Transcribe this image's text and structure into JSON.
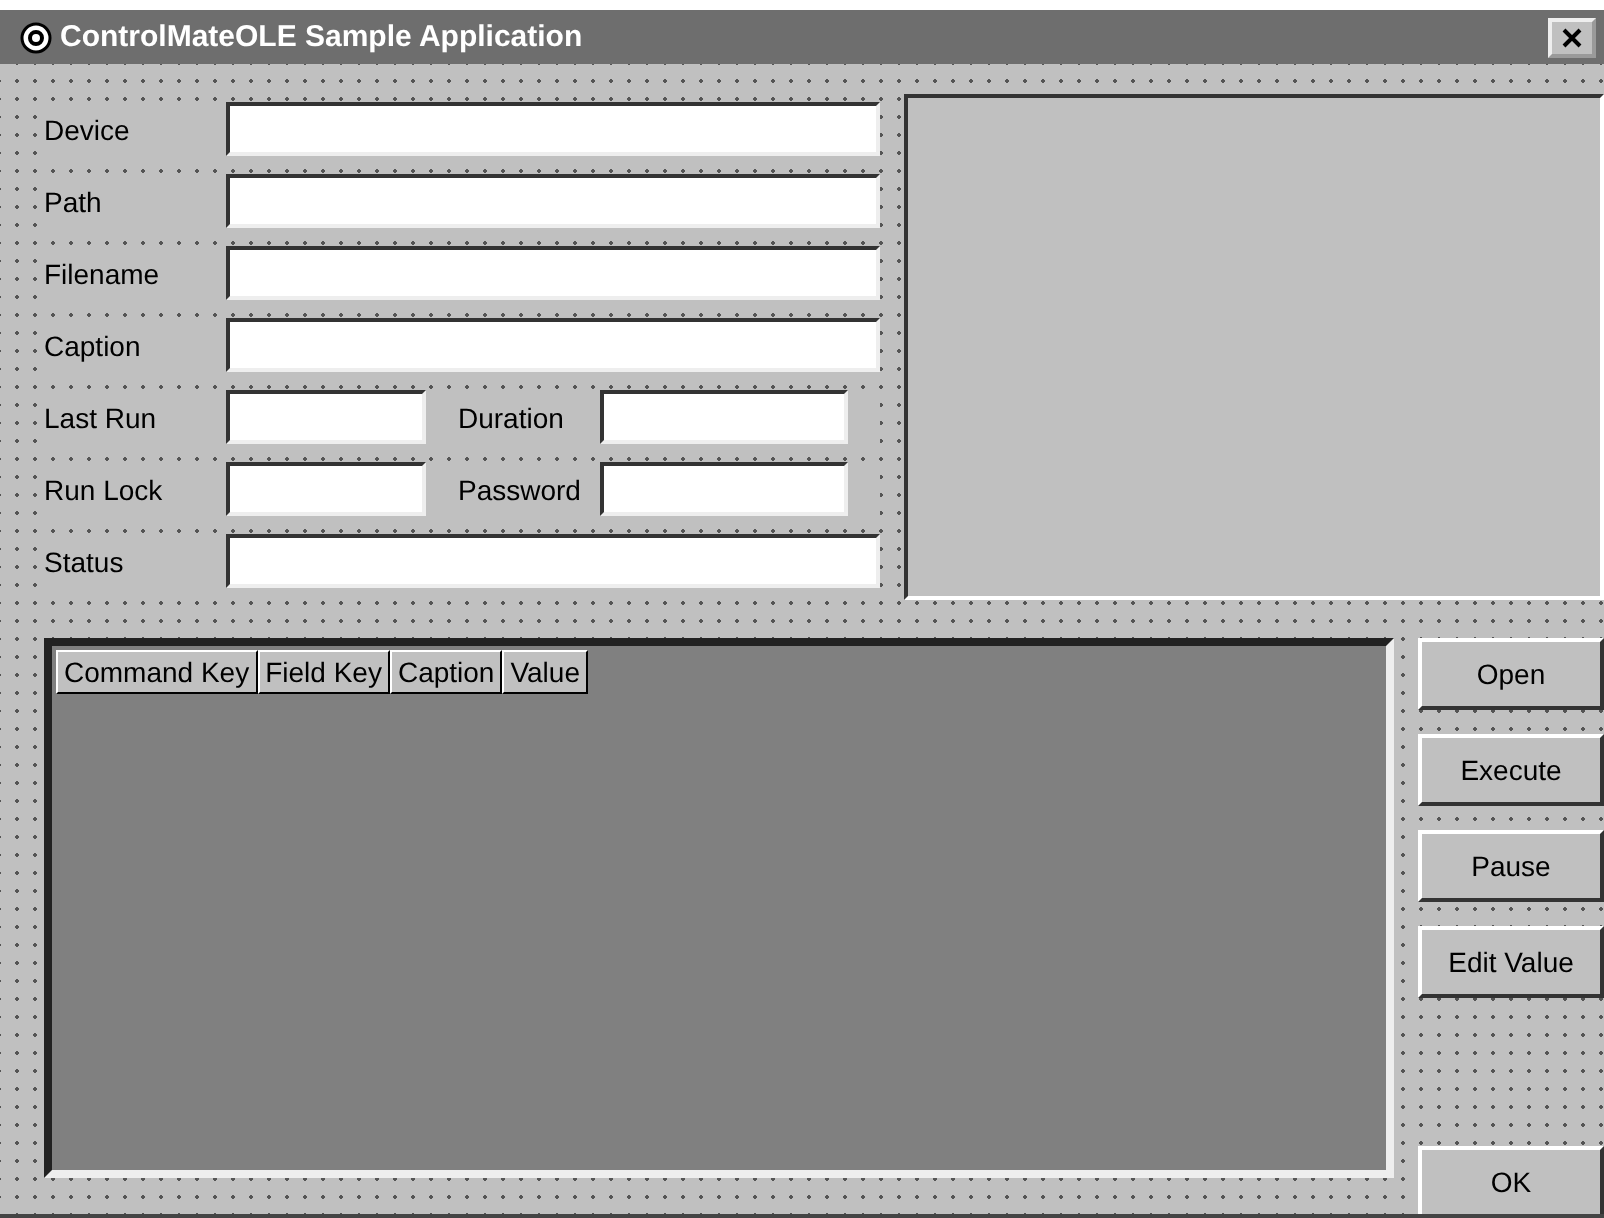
{
  "window": {
    "title": "ControlMateOLE Sample Application"
  },
  "fields": [
    {
      "kind": "full",
      "label": "Device"
    },
    {
      "kind": "full",
      "label": "Path"
    },
    {
      "kind": "full",
      "label": "Filename"
    },
    {
      "kind": "full",
      "label": "Caption"
    },
    {
      "kind": "pair",
      "label": "Last Run",
      "label_2": "Duration"
    },
    {
      "kind": "pair",
      "label": "Run Lock",
      "label_2": "Password"
    },
    {
      "kind": "full",
      "label": "Status"
    }
  ],
  "table": {
    "columns": [
      "Command Key",
      "Field Key",
      "Caption",
      "Value"
    ]
  },
  "buttons": [
    "Open",
    "Execute",
    "Pause",
    "Edit Value"
  ],
  "ok_button": "OK"
}
